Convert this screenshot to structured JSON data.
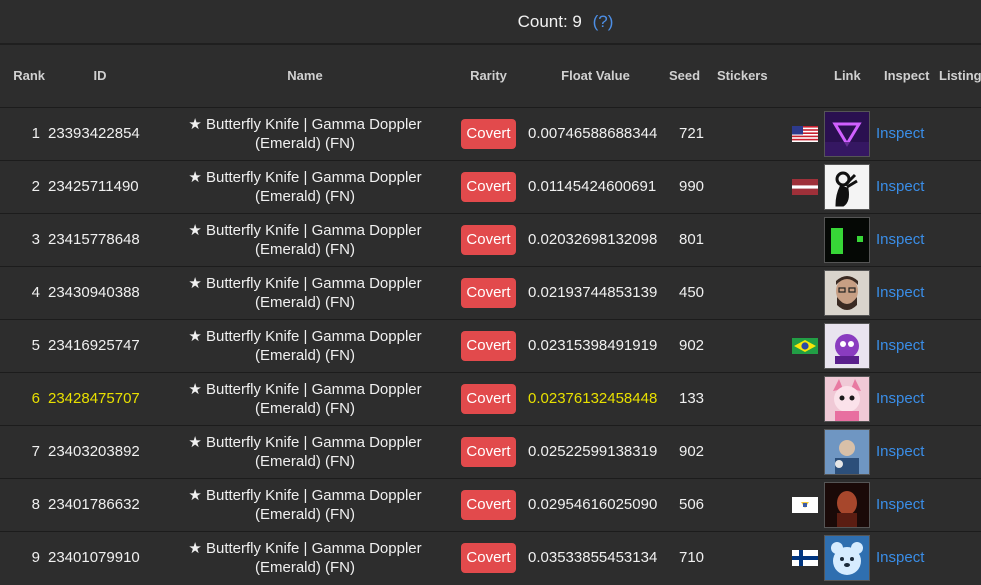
{
  "header": {
    "count_label": "Count: 9",
    "help_label": "(?)"
  },
  "columns": {
    "rank": "Rank",
    "id": "ID",
    "name": "Name",
    "rarity": "Rarity",
    "float": "Float Value",
    "seed": "Seed",
    "stickers": "Stickers",
    "link": "Link",
    "inspect": "Inspect",
    "listing": "Listing"
  },
  "colors": {
    "highlight": "#e8e000",
    "covert": "#e24a4c",
    "link": "#3a8ee8"
  },
  "rows": [
    {
      "rank": "1",
      "id": "23393422854",
      "name1": "★ Butterfly Knife | Gamma Doppler",
      "name2": "(Emerald) (FN)",
      "rarity": "Covert",
      "float": "0.00746588688344",
      "seed": "721",
      "flag": "us-flag",
      "avatar": "neon-triangle-avatar",
      "inspect": "Inspect"
    },
    {
      "rank": "2",
      "id": "23425711490",
      "name1": "★ Butterfly Knife | Gamma Doppler",
      "name2": "(Emerald) (FN)",
      "rarity": "Covert",
      "float": "0.01145424600691",
      "seed": "990",
      "flag": "latvia-flag",
      "avatar": "ok-hand-avatar",
      "inspect": "Inspect"
    },
    {
      "rank": "3",
      "id": "23415778648",
      "name1": "★ Butterfly Knife | Gamma Doppler",
      "name2": "(Emerald) (FN)",
      "rarity": "Covert",
      "float": "0.02032698132098",
      "seed": "801",
      "flag": "",
      "avatar": "green-game-avatar",
      "inspect": "Inspect"
    },
    {
      "rank": "4",
      "id": "23430940388",
      "name1": "★ Butterfly Knife | Gamma Doppler",
      "name2": "(Emerald) (FN)",
      "rarity": "Covert",
      "float": "0.02193744853139",
      "seed": "450",
      "flag": "",
      "avatar": "man-photo-avatar",
      "inspect": "Inspect"
    },
    {
      "rank": "5",
      "id": "23416925747",
      "name1": "★ Butterfly Knife | Gamma Doppler",
      "name2": "(Emerald) (FN)",
      "rarity": "Covert",
      "float": "0.02315398491919",
      "seed": "902",
      "flag": "brazil-flag",
      "avatar": "purple-character-avatar",
      "inspect": "Inspect"
    },
    {
      "rank": "6",
      "id": "23428475707",
      "name1": "★ Butterfly Knife | Gamma Doppler",
      "name2": "(Emerald) (FN)",
      "rarity": "Covert",
      "float": "0.02376132458448",
      "seed": "133",
      "flag": "",
      "avatar": "anime-character-avatar",
      "inspect": "Inspect",
      "highlighted": true
    },
    {
      "rank": "7",
      "id": "23403203892",
      "name1": "★ Butterfly Knife | Gamma Doppler",
      "name2": "(Emerald) (FN)",
      "rarity": "Covert",
      "float": "0.02522599138319",
      "seed": "902",
      "flag": "",
      "avatar": "blue-person-avatar",
      "inspect": "Inspect"
    },
    {
      "rank": "8",
      "id": "23401786632",
      "name1": "★ Butterfly Knife | Gamma Doppler",
      "name2": "(Emerald) (FN)",
      "rarity": "Covert",
      "float": "0.02954616025090",
      "seed": "506",
      "flag": "virgin-islands-flag",
      "avatar": "red-portrait-avatar",
      "inspect": "Inspect"
    },
    {
      "rank": "9",
      "id": "23401079910",
      "name1": "★ Butterfly Knife | Gamma Doppler",
      "name2": "(Emerald) (FN)",
      "rarity": "Covert",
      "float": "0.03533855453134",
      "seed": "710",
      "flag": "finland-flag",
      "avatar": "blue-bear-avatar",
      "inspect": "Inspect"
    }
  ]
}
